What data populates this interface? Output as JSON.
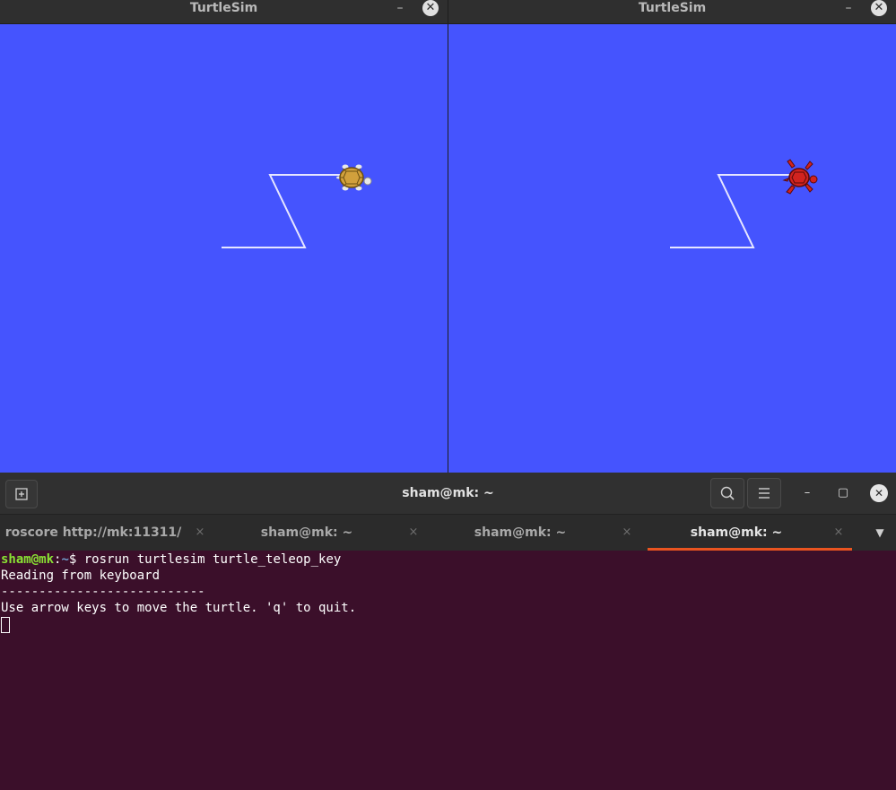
{
  "windows": {
    "left": {
      "title": "TurtleSim",
      "minimize": "–",
      "close": "✕",
      "turtle_color": "#d1a03c"
    },
    "right": {
      "title": "TurtleSim",
      "minimize": "–",
      "close": "✕",
      "turtle_color": "#d2231f"
    }
  },
  "canvas": {
    "background": "#4554fe",
    "trail_color": "#e6e6ff"
  },
  "terminal": {
    "title": "sham@mk: ~",
    "minimize": "–",
    "maximize": "▢",
    "close": "✕",
    "tabs": [
      {
        "label": "roscore http://mk:11311/",
        "close": "×"
      },
      {
        "label": "sham@mk: ~",
        "close": "×"
      },
      {
        "label": "sham@mk: ~",
        "close": "×"
      },
      {
        "label": "sham@mk: ~",
        "close": "×"
      }
    ],
    "tabs_menu": "▼",
    "prompt": {
      "user": "sham@mk",
      "sep": ":",
      "path": "~",
      "dollar": "$ ",
      "command": "rosrun turtlesim turtle_teleop_key"
    },
    "output": [
      "Reading from keyboard",
      "---------------------------",
      "Use arrow keys to move the turtle. 'q' to quit."
    ]
  },
  "colors": {
    "accent": "#e95420",
    "terminal_bg": "#3b0f2a",
    "prompt_user": "#8ae234",
    "prompt_path": "#729fcf"
  }
}
